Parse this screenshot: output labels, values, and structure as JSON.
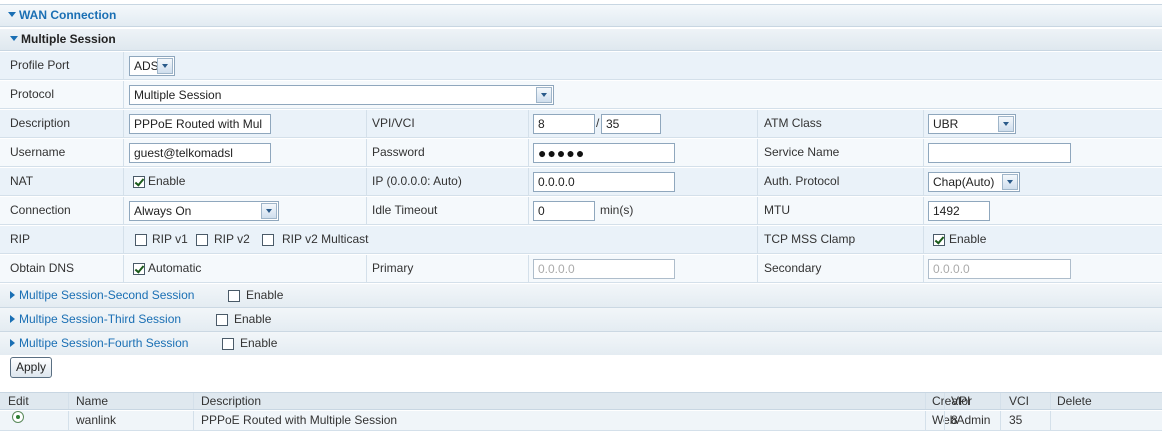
{
  "wan": {
    "title": "WAN Connection"
  },
  "section": {
    "title": "Multiple Session"
  },
  "form": {
    "profile_port": {
      "label": "Profile Port",
      "value": "ADSL"
    },
    "protocol": {
      "label": "Protocol",
      "value": "Multiple Session"
    },
    "description": {
      "label": "Description",
      "value": "PPPoE Routed with Mul"
    },
    "vpivci": {
      "label": "VPI/VCI",
      "vpi": "8",
      "separator": "/",
      "vci": "35"
    },
    "atm_class": {
      "label": "ATM Class",
      "value": "UBR"
    },
    "username": {
      "label": "Username",
      "value": "guest@telkomadsl"
    },
    "password": {
      "label": "Password",
      "value": "●●●●●"
    },
    "service_name": {
      "label": "Service Name",
      "value": ""
    },
    "nat": {
      "label": "NAT",
      "option": "Enable",
      "checked": true
    },
    "ip": {
      "label": "IP (0.0.0.0: Auto)",
      "value": "0.0.0.0"
    },
    "auth_protocol": {
      "label": "Auth. Protocol",
      "value": "Chap(Auto)"
    },
    "connection": {
      "label": "Connection",
      "value": "Always On"
    },
    "idle_timeout": {
      "label": "Idle Timeout",
      "value": "0",
      "unit": "min(s)"
    },
    "mtu": {
      "label": "MTU",
      "value": "1492"
    },
    "rip": {
      "label": "RIP",
      "options": [
        "RIP v1",
        "RIP v2",
        "RIP v2 Multicast"
      ]
    },
    "tcp_mss": {
      "label": "TCP MSS Clamp",
      "option": "Enable",
      "checked": true
    },
    "obtain_dns": {
      "label": "Obtain DNS",
      "option": "Automatic",
      "checked": true
    },
    "primary": {
      "label": "Primary",
      "placeholder": "0.0.0.0"
    },
    "secondary": {
      "label": "Secondary",
      "placeholder": "0.0.0.0"
    }
  },
  "sessions": [
    {
      "title": "Multipe Session-Second Session",
      "enable": "Enable"
    },
    {
      "title": "Multipe Session-Third Session",
      "enable": "Enable"
    },
    {
      "title": "Multipe Session-Fourth Session",
      "enable": "Enable"
    }
  ],
  "apply": {
    "label": "Apply"
  },
  "table": {
    "headers": [
      "Edit",
      "Name",
      "Description",
      "Creator",
      "VPI",
      "VCI",
      "Delete"
    ],
    "rows": [
      {
        "name": "wanlink",
        "description": "PPPoE Routed with Multiple Session",
        "creator": "WebAdmin",
        "vpi": "8",
        "vci": "35"
      }
    ]
  },
  "colors": {
    "accent": "#1a6fb4",
    "row_alt": "#eaf2f9",
    "header_bg": "#dfe8ef"
  }
}
